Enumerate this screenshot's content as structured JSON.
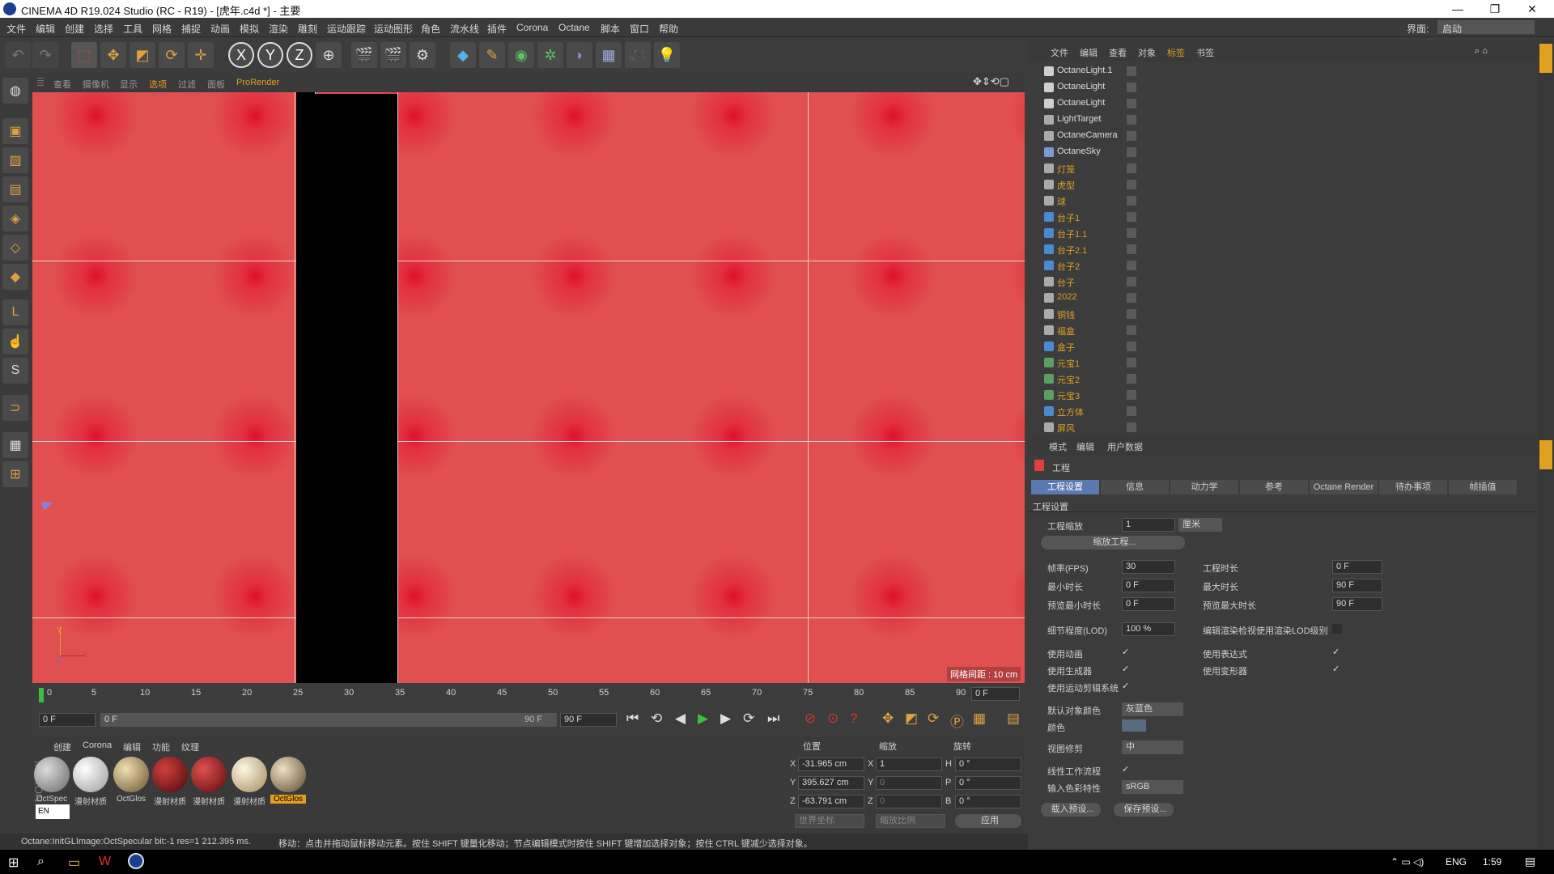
{
  "window": {
    "title": "CINEMA 4D R19.024 Studio (RC - R19) - [虎年.c4d *] - 主要",
    "minimize": "—",
    "maximize": "❐",
    "close": "✕"
  },
  "menu": [
    "文件",
    "编辑",
    "创建",
    "选择",
    "工具",
    "网格",
    "捕捉",
    "动画",
    "模拟",
    "渲染",
    "雕刻",
    "运动跟踪",
    "运动图形",
    "角色",
    "流水线",
    "插件",
    "Corona",
    "Octane",
    "脚本",
    "窗口",
    "帮助"
  ],
  "interface": {
    "label": "界面:",
    "value": "启动"
  },
  "viewport": {
    "menu": [
      "查看",
      "摄像机",
      "显示",
      "选项",
      "过滤",
      "面板",
      "ProRender"
    ],
    "grid_spacing": "网格间距 : 10 cm",
    "axis_y": "Y",
    "axis_x": "X",
    "axis_z": "Z"
  },
  "timeline": {
    "ticks": [
      "0",
      "5",
      "10",
      "15",
      "20",
      "25",
      "30",
      "35",
      "40",
      "45",
      "50",
      "55",
      "60",
      "65",
      "70",
      "75",
      "80",
      "85",
      "90"
    ],
    "end_frame": "0 F"
  },
  "controls": {
    "start": "0 F",
    "range_start": "0 F",
    "range_end": "90 F",
    "end": "90 F"
  },
  "material_panel": {
    "menu": [
      "创建",
      "Corona",
      "编辑",
      "功能",
      "纹理"
    ],
    "materials": [
      {
        "name": "OctSpec",
        "color": "#8a8a8a"
      },
      {
        "name": "漫射材质",
        "color": "#e8e8e8"
      },
      {
        "name": "OctGlos",
        "color": "#b89a6a"
      },
      {
        "name": "漫射材质",
        "color": "#8a1a1a"
      },
      {
        "name": "漫射材质",
        "color": "#a52020"
      },
      {
        "name": "漫射材质",
        "color": "#d8c8a0"
      },
      {
        "name": "OctGlos",
        "color": "#a89070"
      }
    ],
    "lang": "EN"
  },
  "coords": {
    "headers": [
      "位置",
      "缩放",
      "旋转"
    ],
    "pos": {
      "x": "-31.965 cm",
      "y": "395.627 cm",
      "z": "-63.791 cm"
    },
    "scale": {
      "x": "1",
      "y": "0",
      "z": "0"
    },
    "rot": {
      "h": "0 °",
      "p": "0 °",
      "b": "0 °"
    },
    "labels": {
      "x": "X",
      "y": "Y",
      "z": "Z",
      "h": "H",
      "p": "P",
      "b": "B"
    },
    "world": "世界坐标",
    "scale_ratio": "缩放比例",
    "apply": "应用"
  },
  "status": {
    "left": "Octane:InitGLImage:OctSpecular bit:-1 res=1 212.395 ms.",
    "right": "移动：点击并拖动鼠标移动元素。按住 SHIFT 键量化移动；节点编辑模式时按住 SHIFT 键增加选择对象；按住 CTRL 键减少选择对象。"
  },
  "object_manager": {
    "menu": [
      "文件",
      "编辑",
      "查看",
      "对象",
      "标签",
      "书签"
    ],
    "objects": [
      {
        "name": "OctaneLight.1",
        "color": "#ddd",
        "icon": "#cfcfcf"
      },
      {
        "name": "OctaneLight",
        "color": "#ddd",
        "icon": "#cfcfcf"
      },
      {
        "name": "OctaneLight",
        "color": "#ddd",
        "icon": "#cfcfcf"
      },
      {
        "name": "LightTarget",
        "color": "#ddd",
        "icon": "#aaa"
      },
      {
        "name": "OctaneCamera",
        "color": "#ddd",
        "icon": "#aaa"
      },
      {
        "name": "OctaneSky",
        "color": "#ddd",
        "icon": "#7a9ad0"
      },
      {
        "name": "灯笼",
        "color": "#e0a020",
        "icon": "#aaa"
      },
      {
        "name": "虎型",
        "color": "#e0a020",
        "icon": "#aaa"
      },
      {
        "name": "球",
        "color": "#e0a020",
        "icon": "#aaa"
      },
      {
        "name": "台子1",
        "color": "#e0a020",
        "icon": "#4a8ad0"
      },
      {
        "name": "台子1.1",
        "color": "#e0a020",
        "icon": "#4a8ad0"
      },
      {
        "name": "台子2.1",
        "color": "#e0a020",
        "icon": "#4a8ad0"
      },
      {
        "name": "台子2",
        "color": "#e0a020",
        "icon": "#4a8ad0"
      },
      {
        "name": "台子",
        "color": "#e0a020",
        "icon": "#aaa"
      },
      {
        "name": "2022",
        "color": "#e0a020",
        "icon": "#aaa"
      },
      {
        "name": "铜钱",
        "color": "#e0a020",
        "icon": "#aaa"
      },
      {
        "name": "福盒",
        "color": "#e0a020",
        "icon": "#aaa"
      },
      {
        "name": "盒子",
        "color": "#e0a020",
        "icon": "#4a8ad0"
      },
      {
        "name": "元宝1",
        "color": "#e0a020",
        "icon": "#5aa060"
      },
      {
        "name": "元宝2",
        "color": "#e0a020",
        "icon": "#5aa060"
      },
      {
        "name": "元宝3",
        "color": "#e0a020",
        "icon": "#5aa060"
      },
      {
        "name": "立方体",
        "color": "#e0a020",
        "icon": "#4a8ad0"
      },
      {
        "name": "屏风",
        "color": "#e0a020",
        "icon": "#aaa"
      }
    ]
  },
  "attributes": {
    "menu": [
      "模式",
      "编辑",
      "用户数据"
    ],
    "title": "工程",
    "tabs": [
      "工程设置",
      "信息",
      "动力学",
      "参考",
      "Octane Render",
      "待办事项",
      "帧插值"
    ],
    "section": "工程设置",
    "scale_label": "工程缩放",
    "scale_value": "1",
    "scale_unit": "厘米",
    "scale_btn": "缩放工程...",
    "fps_label": "帧率(FPS)",
    "fps": "30",
    "len_label": "工程时长",
    "len": "0 F",
    "min_label": "最小时长",
    "min": "0 F",
    "max_label": "最大时长",
    "max": "90 F",
    "pmin_label": "预览最小时长",
    "pmin": "0 F",
    "pmax_label": "预览最大时长",
    "pmax": "90 F",
    "lod_label": "细节程度(LOD)",
    "lod": "100 %",
    "lod_opt": "编辑渲染检视使用渲染LOD级别",
    "anim": "使用动画",
    "expr": "使用表达式",
    "gen": "使用生成器",
    "deform": "使用变形器",
    "mograph": "使用运动剪辑系统",
    "defcolor_label": "默认对象颜色",
    "defcolor": "灰蓝色",
    "color_label": "颜色",
    "viewclip_label": "视图修剪",
    "viewclip": "中",
    "linear": "线性工作流程",
    "colorprof_label": "输入色彩特性",
    "colorprof": "sRGB",
    "load": "载入预设...",
    "save": "保存预设..."
  },
  "taskbar": {
    "lang": "ENG",
    "time": "1:59"
  }
}
